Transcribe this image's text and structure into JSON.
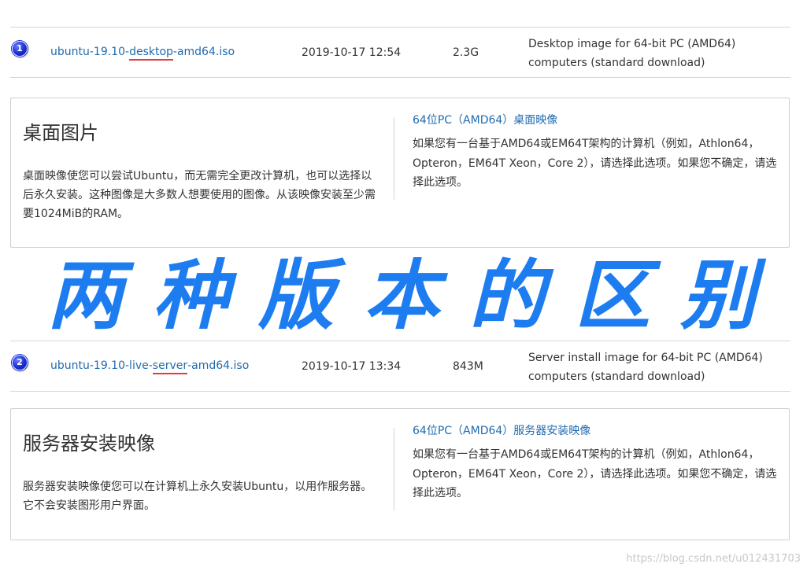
{
  "entries": [
    {
      "badge": "1",
      "file_prefix": "ubuntu-19.10-",
      "file_highlight": "desktop",
      "file_suffix": "-amd64.iso",
      "date": "2019-10-17 12:54",
      "size": "2.3G",
      "description": "Desktop image for 64-bit PC (AMD64) computers (standard download)",
      "card": {
        "title": "桌面图片",
        "text": "桌面映像使您可以尝试Ubuntu，而无需完全更改计算机，也可以选择以后永久安装。这种图像是大多数人想要使用的图像。从该映像安装至少需要1024MiB的RAM。",
        "subtitle": "64位PC（AMD64）桌面映像",
        "body": "如果您有一台基于AMD64或EM64T架构的计算机（例如，Athlon64，Opteron，EM64T Xeon，Core 2），请选择此选项。如果您不确定，请选择此选项。"
      }
    },
    {
      "badge": "2",
      "file_prefix": "ubuntu-19.10-live-",
      "file_highlight": "server",
      "file_suffix": "-amd64.iso",
      "date": "2019-10-17 13:34",
      "size": "843M",
      "description": "Server install image for 64-bit PC (AMD64) computers (standard download)",
      "card": {
        "title": "服务器安装映像",
        "text": "服务器安装映像使您可以在计算机上永久安装Ubuntu，以用作服务器。它不会安装图形用户界面。",
        "subtitle": "64位PC（AMD64）服务器安装映像",
        "body": "如果您有一台基于AMD64或EM64T架构的计算机（例如，Athlon64，Opteron，EM64T Xeon，Core 2），请选择此选项。如果您不确定，请选择此选项。"
      }
    }
  ],
  "banner_chars": [
    "两",
    "种",
    "版",
    "本",
    "的",
    "区",
    "别"
  ],
  "watermark": "https://blog.csdn.net/u012431703",
  "colors": {
    "link": "#1f6bb0",
    "highlight_underline": "#e53a3a",
    "banner": "#1d7df0",
    "badge": "#1a2fd0"
  }
}
